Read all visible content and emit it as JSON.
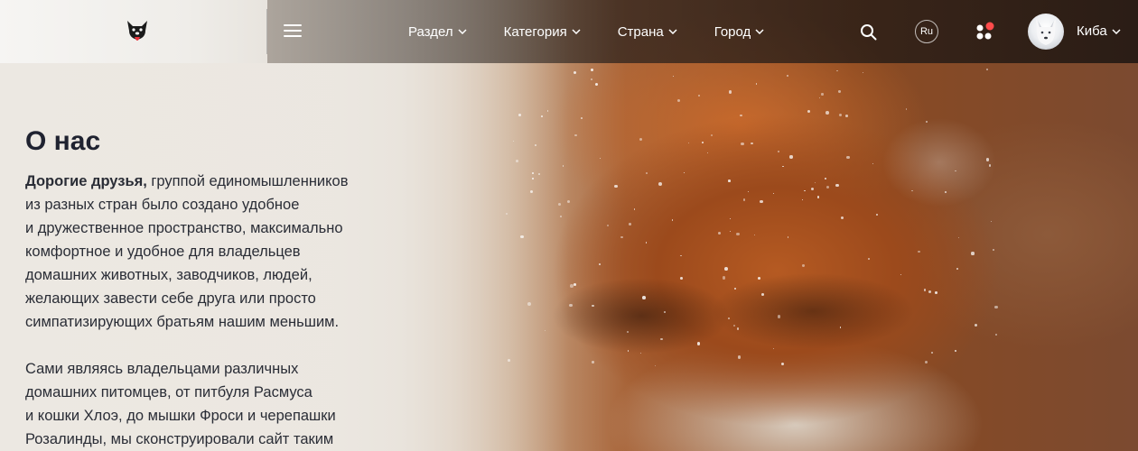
{
  "header": {
    "nav": [
      {
        "label": "Раздел"
      },
      {
        "label": "Категория"
      },
      {
        "label": "Страна"
      },
      {
        "label": "Город"
      }
    ],
    "language": "Ru",
    "user": {
      "name": "Киба"
    },
    "icons": {
      "logo": "dog-face-logo",
      "menu": "hamburger-menu-icon",
      "search": "search-icon",
      "apps": "apps-icon",
      "notification_dot_color": "#ff4b4b"
    }
  },
  "about": {
    "title": "О нас",
    "paragraph1": {
      "lead": "Дорогие друзья,",
      "line1_rest": " группой единомышленников",
      "lines": [
        "из разных стран было создано удобное",
        "и дружественное пространство, максимально",
        "комфортное и удобное для владельцев",
        "домашних животных, заводчиков, людей,",
        "желающих завести себе друга или просто",
        "симпатизирующих братьям нашим меньшим."
      ]
    },
    "paragraph2": {
      "lines": [
        "Сами являясь владельцами различных",
        "домашних питомцев, от питбуля Расмуса",
        "и кошки Хлоэ, до мышки Фроси и черепашки",
        "Розалинды, мы сконструировали сайт таким"
      ]
    }
  }
}
